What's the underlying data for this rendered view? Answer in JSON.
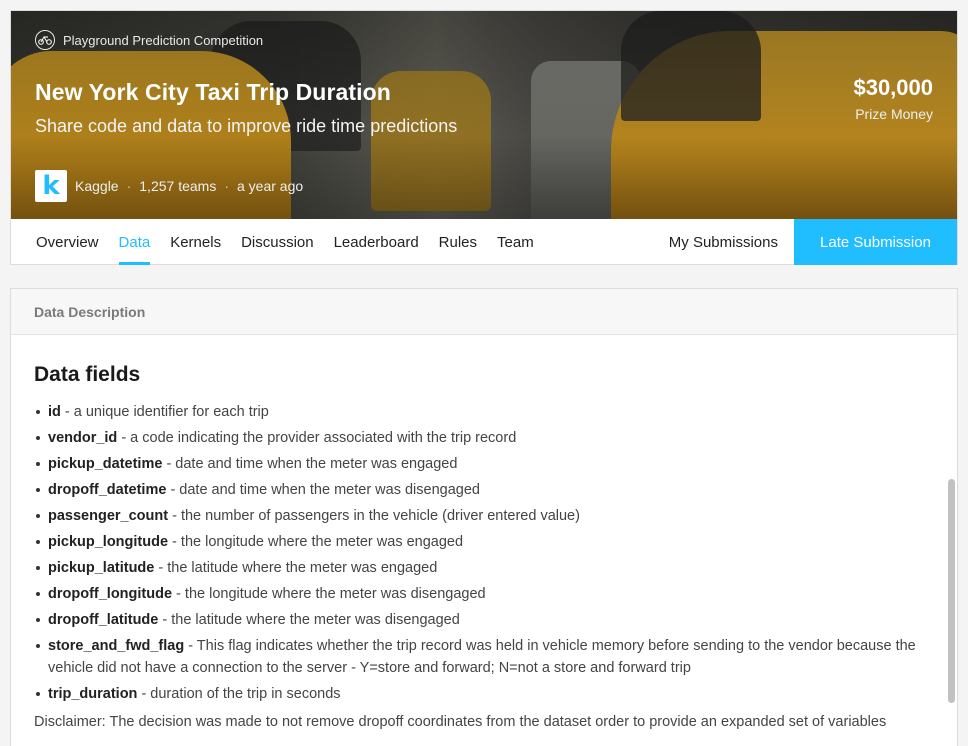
{
  "competition": {
    "type": "Playground Prediction Competition",
    "title": "New York City Taxi Trip Duration",
    "subtitle": "Share code and data to improve ride time predictions",
    "prize_amount": "$30,000",
    "prize_label": "Prize Money",
    "host": "Kaggle",
    "teams": "1,257 teams",
    "age": "a year ago",
    "host_logo_letter": "k"
  },
  "tabs": [
    {
      "label": "Overview"
    },
    {
      "label": "Data",
      "active": true
    },
    {
      "label": "Kernels"
    },
    {
      "label": "Discussion"
    },
    {
      "label": "Leaderboard"
    },
    {
      "label": "Rules"
    },
    {
      "label": "Team"
    }
  ],
  "actions": {
    "my_submissions": "My Submissions",
    "late_submission": "Late Submission"
  },
  "data_description": {
    "section_label": "Data Description",
    "heading": "Data fields",
    "fields": [
      {
        "name": "id",
        "desc": " - a unique identifier for each trip"
      },
      {
        "name": "vendor_id",
        "desc": " - a code indicating the provider associated with the trip record"
      },
      {
        "name": "pickup_datetime",
        "desc": " - date and time when the meter was engaged"
      },
      {
        "name": "dropoff_datetime",
        "desc": " - date and time when the meter was disengaged"
      },
      {
        "name": "passenger_count",
        "desc": " - the number of passengers in the vehicle (driver entered value)"
      },
      {
        "name": "pickup_longitude",
        "desc": " - the longitude where the meter was engaged"
      },
      {
        "name": "pickup_latitude",
        "desc": " - the latitude where the meter was engaged"
      },
      {
        "name": "dropoff_longitude",
        "desc": " - the longitude where the meter was disengaged"
      },
      {
        "name": "dropoff_latitude",
        "desc": " - the latitude where the meter was disengaged"
      },
      {
        "name": "store_and_fwd_flag",
        "desc": " - This flag indicates whether the trip record was held in vehicle memory before sending to the vendor because the vehicle did not have a connection to the server - Y=store and forward; N=not a store and forward trip"
      },
      {
        "name": "trip_duration",
        "desc": " - duration of the trip in seconds"
      }
    ],
    "disclaimer": "Disclaimer: The decision was made to not remove dropoff coordinates from the dataset order to provide an expanded set of variables"
  },
  "colors": {
    "accent": "#20beff"
  }
}
